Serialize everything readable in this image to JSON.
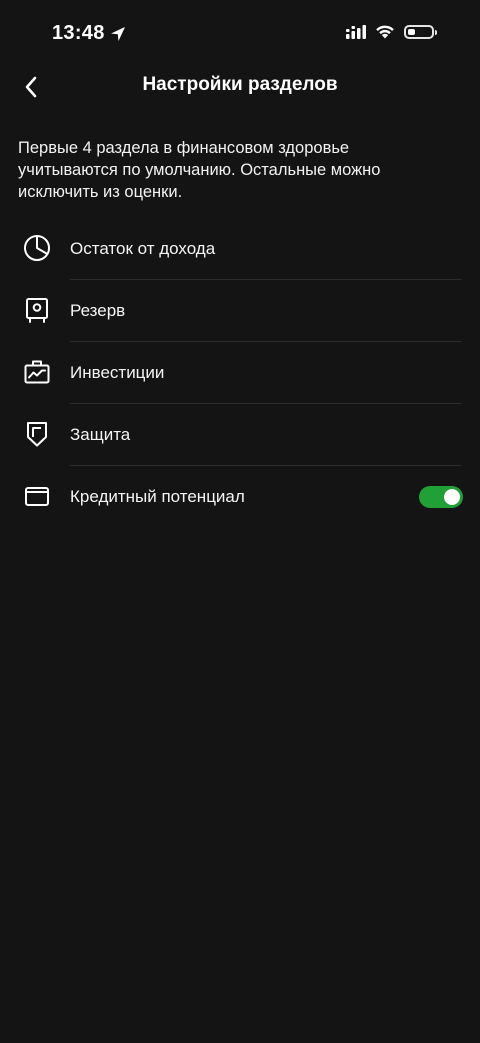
{
  "status_bar": {
    "time": "13:48",
    "location_icon": "location-arrow-icon",
    "signal_icon": "cellular-signal-icon",
    "wifi_icon": "wifi-icon",
    "battery_icon": "battery-icon",
    "battery_level": 0.3
  },
  "nav": {
    "back_icon": "chevron-left-icon",
    "title": "Настройки разделов"
  },
  "description": "Первые 4 раздела в финансовом здоровье учитываются по умолчанию. Остальные можно исключить из оценки.",
  "sections": [
    {
      "label": "Остаток от дохода",
      "icon": "pie-chart-icon"
    },
    {
      "label": "Резерв",
      "icon": "safe-icon"
    },
    {
      "label": "Инвестиции",
      "icon": "briefcase-chart-icon"
    },
    {
      "label": "Защита",
      "icon": "shield-icon"
    },
    {
      "label": "Кредитный потенциал",
      "icon": "wallet-icon",
      "toggle": true
    }
  ],
  "colors": {
    "background": "#141414",
    "accent_green": "#21a038",
    "text": "#ffffff",
    "divider": "#2c2c2c"
  }
}
